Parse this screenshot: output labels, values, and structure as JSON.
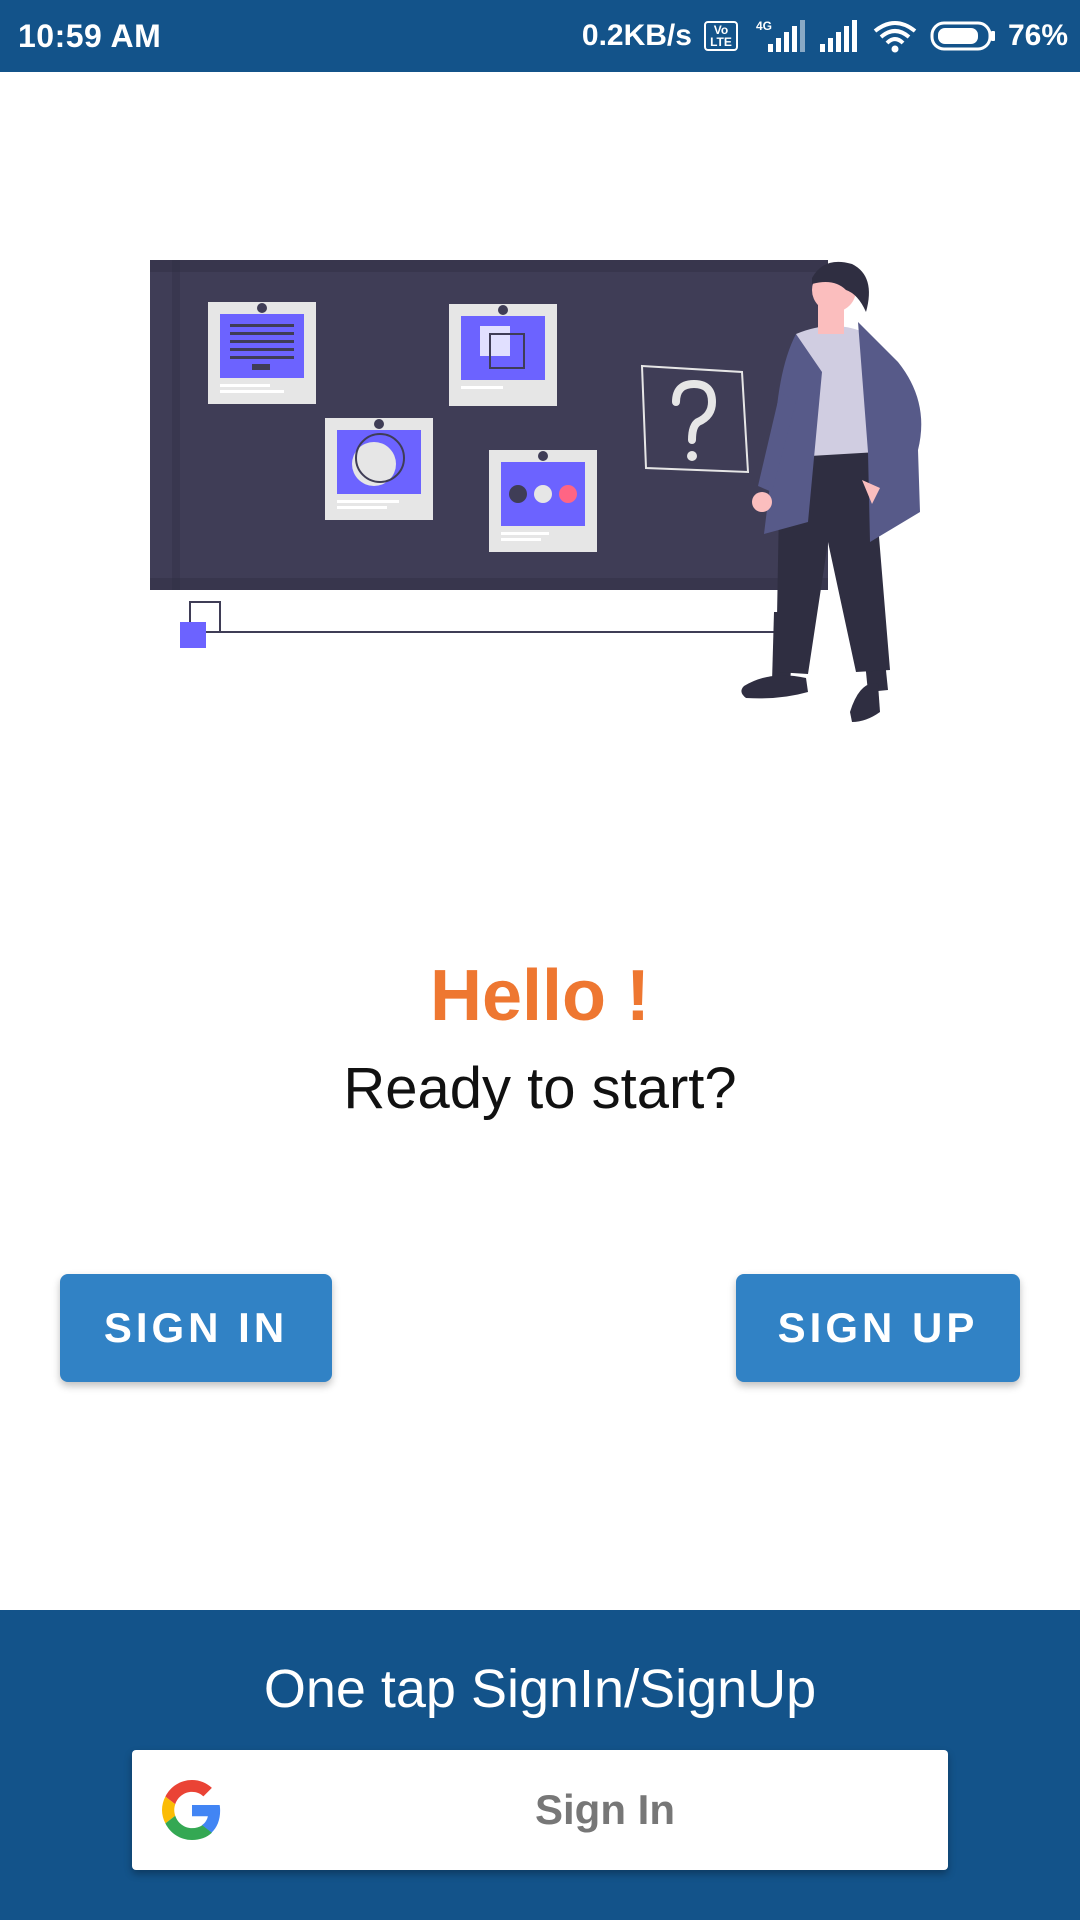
{
  "status_bar": {
    "time": "10:59 AM",
    "net_speed": "0.2KB/s",
    "volte_label": "Vo LTE",
    "network_type": "4G",
    "battery": "76%"
  },
  "greeting": {
    "title": "Hello !",
    "subtitle": "Ready to start?"
  },
  "buttons": {
    "sign_in": "SIGN IN",
    "sign_up": "SIGN UP"
  },
  "one_tap": {
    "heading": "One tap SignIn/SignUp",
    "google_button": "Sign In"
  },
  "colors": {
    "primary": "#13538a",
    "button": "#3182c5",
    "accent": "#ee7731"
  },
  "icons": [
    "volte-icon",
    "signal-icon",
    "wifi-icon",
    "battery-icon",
    "google-icon"
  ]
}
